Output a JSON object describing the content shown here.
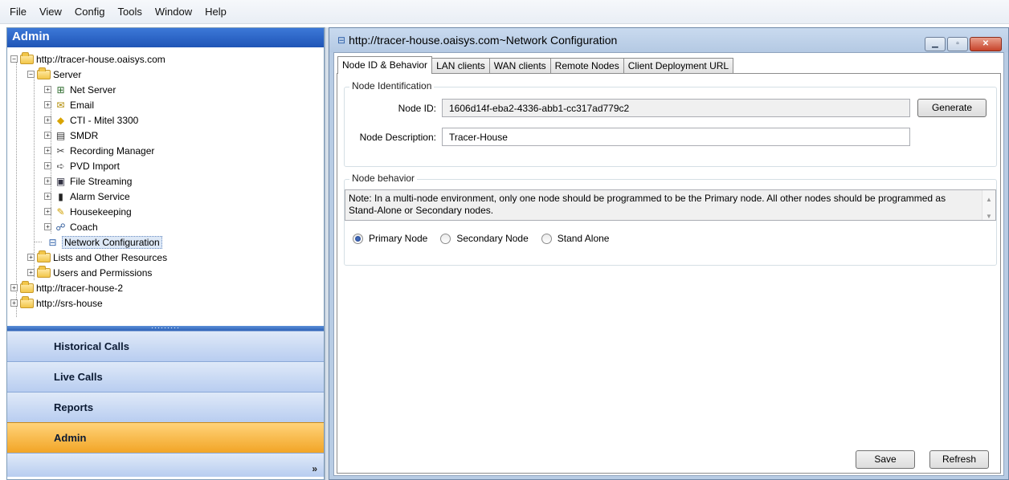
{
  "menu": [
    "File",
    "View",
    "Config",
    "Tools",
    "Window",
    "Help"
  ],
  "left": {
    "header": "Admin",
    "tree": {
      "root": "http://tracer-house.oaisys.com",
      "server": "Server",
      "server_children": [
        "Net Server",
        "Email",
        "CTI - Mitel 3300",
        "SMDR",
        "Recording Manager",
        "PVD Import",
        "File Streaming",
        "Alarm Service",
        "Housekeeping",
        "Coach"
      ],
      "network_config": "Network Configuration",
      "lists": "Lists and Other Resources",
      "users": "Users and Permissions",
      "root2": "http://tracer-house-2",
      "root3": "http://srs-house"
    },
    "nav": [
      "Historical Calls",
      "Live Calls",
      "Reports",
      "Admin"
    ],
    "active_nav": "Admin"
  },
  "window": {
    "title": "http://tracer-house.oaisys.com~Network Configuration",
    "tabs": [
      "Node ID & Behavior",
      "LAN clients",
      "WAN clients",
      "Remote Nodes",
      "Client Deployment URL"
    ],
    "identification": {
      "title": "Node Identification",
      "node_id_label": "Node ID:",
      "node_id_value": "1606d14f-eba2-4336-abb1-cc317ad779c2",
      "generate_label": "Generate",
      "desc_label": "Node Description:",
      "desc_value": "Tracer-House"
    },
    "behavior": {
      "title": "Node behavior",
      "note": "Note:  In a multi-node environment, only one node should be programmed to be the Primary node.  All other nodes should be programmed as Stand-Alone or Secondary nodes.",
      "options": [
        "Primary Node",
        "Secondary Node",
        "Stand Alone"
      ],
      "selected": "Primary Node"
    },
    "save_label": "Save",
    "refresh_label": "Refresh"
  },
  "colors": {
    "active_nav": "#f2a526",
    "header_blue": "#1f55b6"
  }
}
